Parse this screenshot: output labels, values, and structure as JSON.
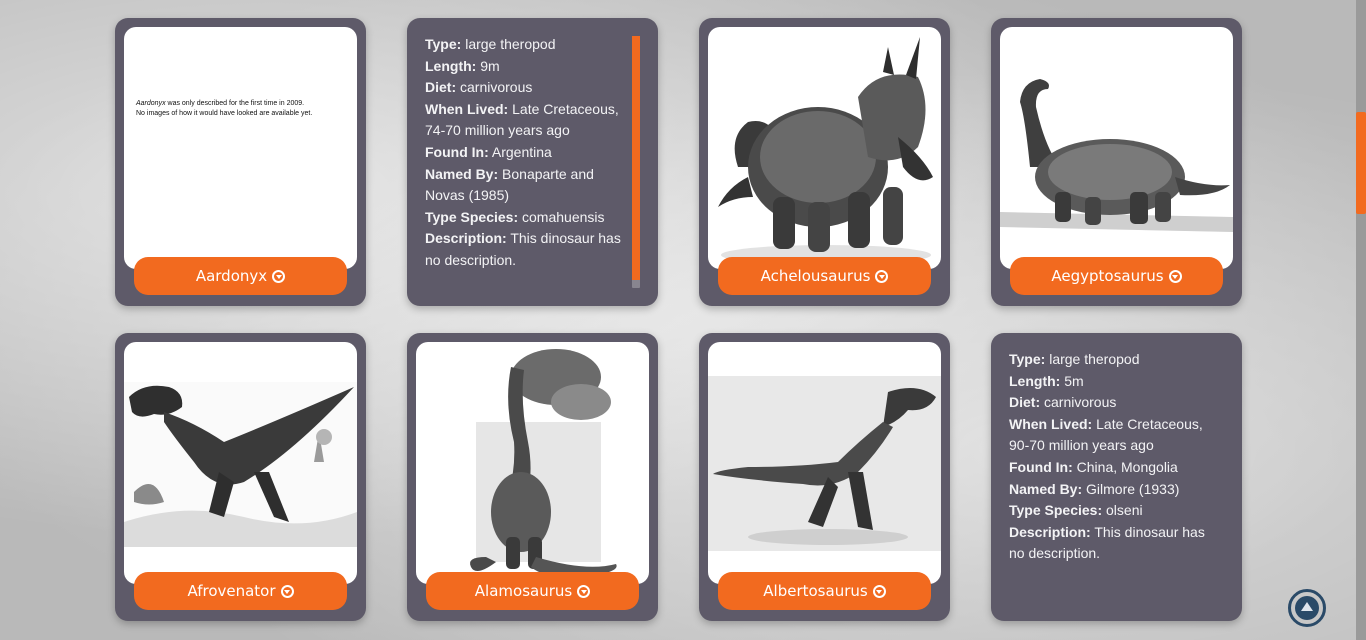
{
  "cards": [
    {
      "name": "Aardonyx",
      "toggle_icon": "chevron-down-circle-icon",
      "note_line1_italic": "Aardonyx",
      "note_line1_rest": " was only described for the first time in 2009.",
      "note_line2": "No images of how it would have looked are available yet."
    },
    {
      "info": [
        {
          "label": "Type:",
          "value": "large theropod"
        },
        {
          "label": "Length:",
          "value": "9m"
        },
        {
          "label": "Diet:",
          "value": "carnivorous"
        },
        {
          "label": "When Lived:",
          "value": "Late Cretaceous, 74-70 million years ago"
        },
        {
          "label": "Found In:",
          "value": "Argentina"
        },
        {
          "label": "Named By:",
          "value": "Bonaparte and Novas (1985)"
        },
        {
          "label": "Type Species:",
          "value": "comahuensis"
        },
        {
          "label": "Description:",
          "value": "This dinosaur has no description."
        }
      ]
    },
    {
      "name": "Achelousaurus",
      "toggle_icon": "chevron-down-circle-icon",
      "image_icon": "ceratopsian-illustration"
    },
    {
      "name": "Aegyptosaurus",
      "toggle_icon": "chevron-down-circle-icon",
      "image_icon": "sauropod-illustration"
    },
    {
      "name": "Afrovenator",
      "toggle_icon": "chevron-down-circle-icon",
      "image_icon": "theropod-illustration"
    },
    {
      "name": "Alamosaurus",
      "toggle_icon": "chevron-down-circle-icon",
      "image_icon": "sauropod-tree-illustration"
    },
    {
      "name": "Albertosaurus",
      "toggle_icon": "chevron-down-circle-icon",
      "image_icon": "tyrannosaur-illustration"
    },
    {
      "info": [
        {
          "label": "Type:",
          "value": "large theropod"
        },
        {
          "label": "Length:",
          "value": "5m"
        },
        {
          "label": "Diet:",
          "value": "carnivorous"
        },
        {
          "label": "When Lived:",
          "value": "Late Cretaceous, 90-70 million years ago"
        },
        {
          "label": "Found In:",
          "value": "China, Mongolia"
        },
        {
          "label": "Named By:",
          "value": "Gilmore (1933)"
        },
        {
          "label": "Type Species:",
          "value": "olseni"
        },
        {
          "label": "Description:",
          "value": "This dinosaur has no description."
        }
      ]
    }
  ],
  "back_to_top_icon": "arrow-up-circle-icon",
  "colors": {
    "card_bg": "#5e5a69",
    "accent": "#f26a1f",
    "back_to_top": "#2a4a68"
  }
}
